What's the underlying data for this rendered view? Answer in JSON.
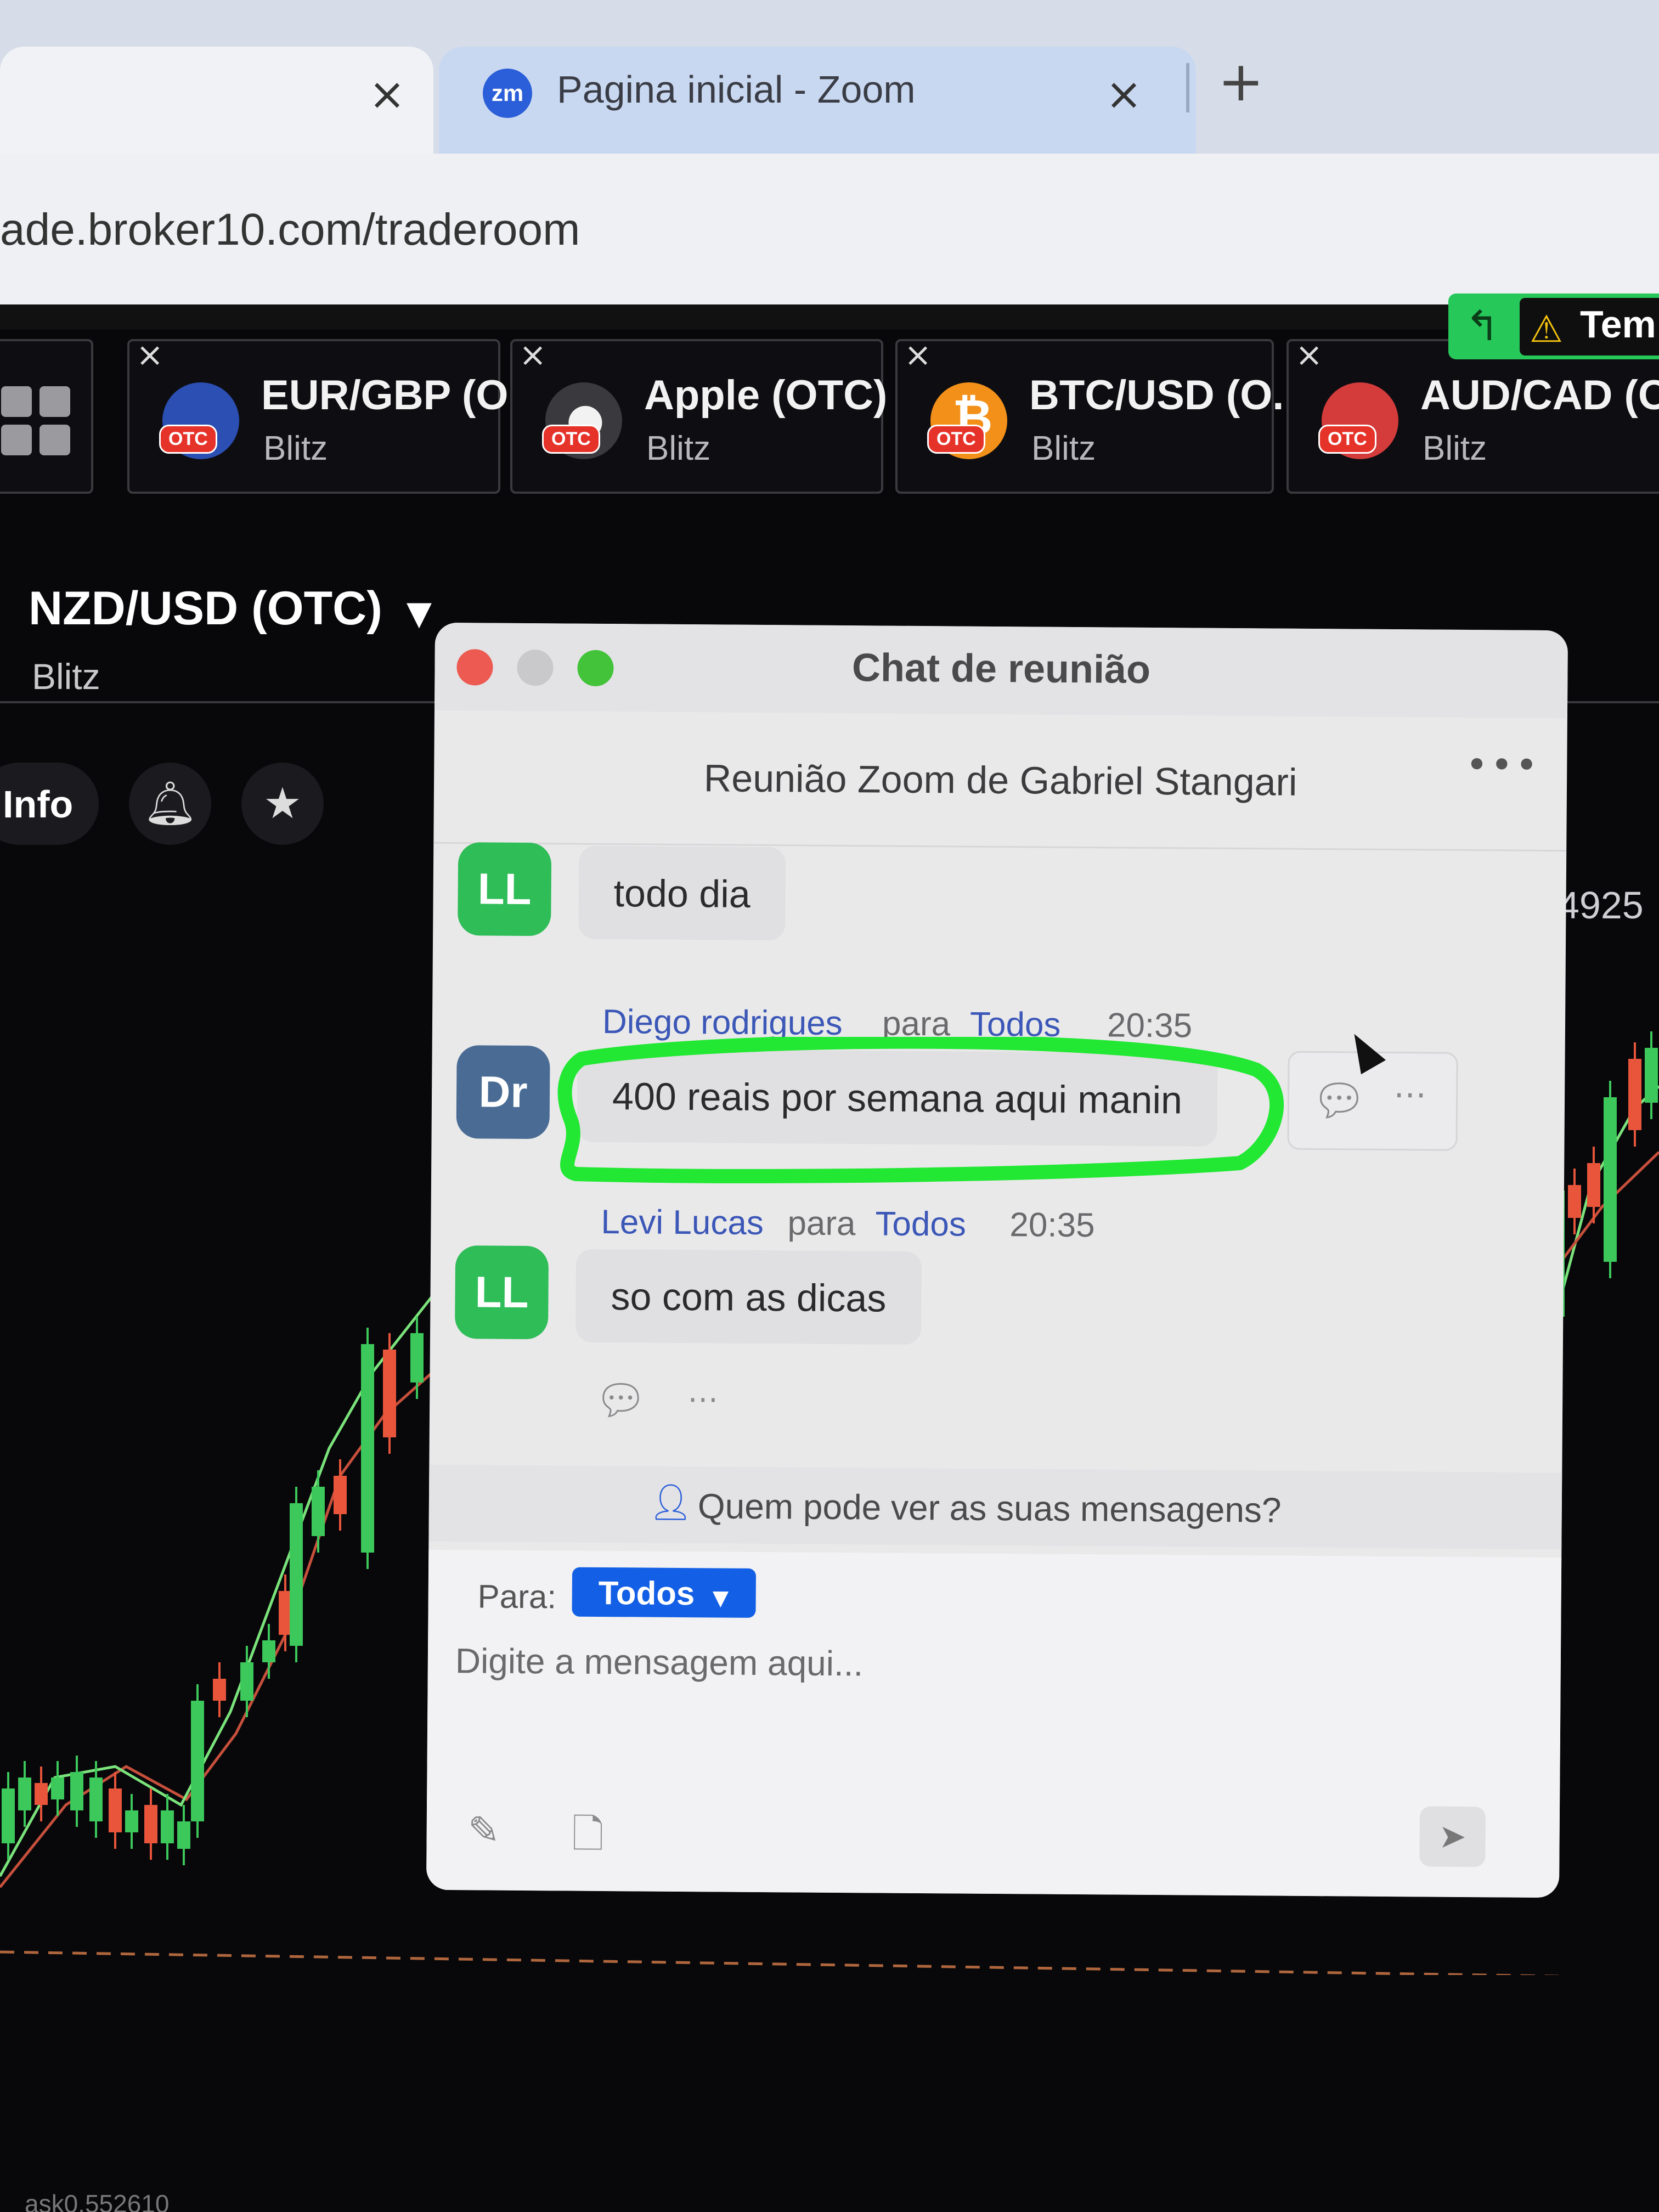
{
  "browser": {
    "tabs": [
      {
        "label": ""
      },
      {
        "label": "Pagina inicial - Zoom",
        "logo": "zm"
      }
    ],
    "close_glyph": "×",
    "newtab_glyph": "+",
    "url": "ade.broker10.com/traderoom"
  },
  "trading": {
    "assets": [
      {
        "name": "EUR/GBP (O...",
        "sub": "Blitz",
        "badge": "OTC",
        "icon_color": "#2b4fb2"
      },
      {
        "name": "Apple (OTC)",
        "sub": "Blitz",
        "badge": "OTC",
        "icon_color": "#f2f2f2"
      },
      {
        "name": "BTC/USD (O...",
        "sub": "Blitz",
        "badge": "OTC",
        "icon_color": "#f39019"
      },
      {
        "name": "AUD/CAD (O",
        "sub": "Blitz",
        "badge": "OTC",
        "icon_color": "#d43b3b"
      }
    ],
    "notification": {
      "text": "Tem"
    },
    "pair": {
      "title": "NZD/USD (OTC)",
      "sub": "Blitz"
    },
    "info_label": "Info",
    "price_label": "4925",
    "ask_label": "ask0.552610",
    "colors": {
      "up": "#3cc85a",
      "down": "#e8553b",
      "ma_green": "#7be37b",
      "ma_red": "#c7503c"
    }
  },
  "zoom_chat": {
    "window_title": "Chat de reunião",
    "meeting_name": "Reunião Zoom de Gabriel Stangari",
    "messages": [
      {
        "initials": "LL",
        "text": "todo dia"
      },
      {
        "initials": "Dr",
        "sender": "Diego rodrigues",
        "to_word": "para",
        "to": "Todos",
        "time": "20:35",
        "text": "400 reais por semana aqui manin"
      },
      {
        "initials": "LL",
        "sender": "Levi Lucas",
        "to_word": "para",
        "to": "Todos",
        "time": "20:35",
        "text": "so com as dicas"
      }
    ],
    "privacy_text": "Quem pode ver as suas mensagens?",
    "compose": {
      "to_label": "Para:",
      "to_value": "Todos",
      "placeholder": "Digite a mensagem aqui..."
    },
    "colors": {
      "highlight": "#22e834",
      "pill": "#1360e6",
      "avatar_ll": "#2fbd58",
      "avatar_dr": "#4a6c94"
    }
  }
}
